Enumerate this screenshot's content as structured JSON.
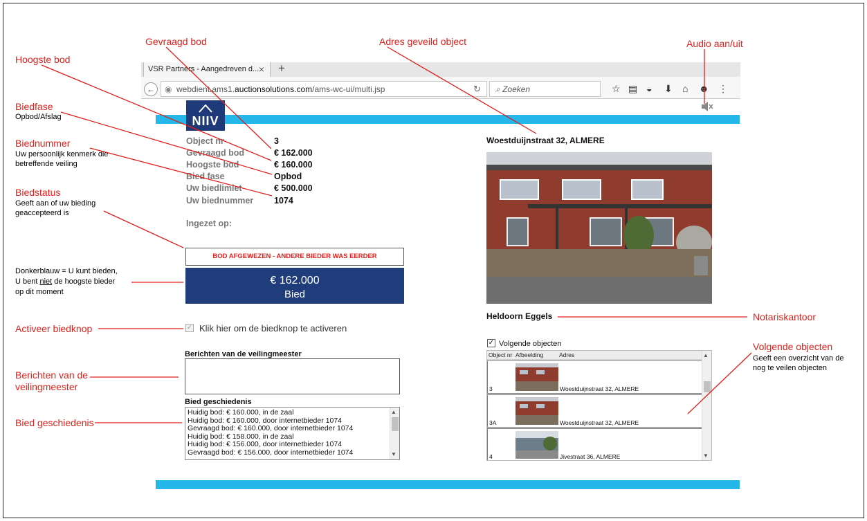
{
  "annotations": {
    "gevraagd_bod": "Gevraagd bod",
    "adres_geveild_object": "Adres geveild object",
    "audio": "Audio aan/uit",
    "hoogste_bod": "Hoogste bod",
    "biedfase": "Biedfase",
    "biedfase_sub": "Opbod/Afslag",
    "biednummer": "Biednummer",
    "biednummer_sub1": "Uw persoonlijk  kenmerk die",
    "biednummer_sub2": "betreffende veiling",
    "biedstatus": "Biedstatus",
    "biedstatus_sub1": "Geeft aan of uw bieding",
    "biedstatus_sub2": "geaccepteerd is",
    "donkerblauw_1": "Donkerblauw = U kunt bieden,",
    "donkerblauw_2a": "U bent ",
    "donkerblauw_2b": "niet",
    "donkerblauw_2c": " de hoogste bieder",
    "donkerblauw_3": "op dit moment",
    "activeer": "Activeer biedknop",
    "berichten_1": "Berichten van de",
    "berichten_2": "veilingmeester",
    "bied_geschiedenis": "Bied geschiedenis",
    "notariskantoor": "Notariskantoor",
    "volgende_objecten": "Volgende objecten",
    "volgende_sub1": "Geeft een overzicht van de",
    "volgende_sub2": "nog te veilen objecten"
  },
  "browser": {
    "tab_title": "VSR Partners - Aangedreven d...",
    "url_prefix": "webdient.ams1.",
    "url_host": "auctionsolutions.com",
    "url_path": "/ams-wc-ui/multi.jsp",
    "search_placeholder": "Zoeken"
  },
  "page": {
    "logo_text": "NIIV",
    "info": [
      {
        "label": "Object nr",
        "value": "3"
      },
      {
        "label": "Gevraagd bod",
        "value": "€ 162.000"
      },
      {
        "label": "Hoogste bod",
        "value": "€ 160.000"
      },
      {
        "label": "Bied fase",
        "value": "Opbod"
      },
      {
        "label": "Uw biedlimiet",
        "value": "€ 500.000"
      },
      {
        "label": "Uw biednummer",
        "value": "1074"
      }
    ],
    "ingezet_op": "Ingezet op:",
    "status": "BOD AFGEWEZEN - ANDERE BIEDER WAS EERDER",
    "bid_amount": "€ 162.000",
    "bid_label": "Bied",
    "activate_label": "Klik hier om de biedknop te activeren",
    "messages_title": "Berichten van de veilingmeester",
    "history_title": "Bied geschiedenis",
    "history": [
      "Huidig bod: € 160.000, in de zaal",
      "Huidig bod: € 160.000, door internetbieder 1074",
      "Gevraagd bod: € 160.000, door internetbieder 1074",
      "Huidig bod: € 158.000, in de zaal",
      "Huidig bod: € 156.000, door internetbieder 1074",
      "Gevraagd bod: € 156.000, door internetbieder 1074"
    ],
    "address": "Woestduijnstraat 32, ALMERE",
    "notaris": "Heldoorn Eggels",
    "next_objects_label": "Volgende objecten",
    "next_objects_headers": [
      "Object nr",
      "Afbeelding",
      "Adres"
    ],
    "next_objects": [
      {
        "nr": "3",
        "adres": "Woestduijnstraat 32, ALMERE"
      },
      {
        "nr": "3A",
        "adres": "Woestduijnstraat 32, ALMERE"
      },
      {
        "nr": "4",
        "adres": "Jivestraat 36, ALMERE"
      }
    ]
  },
  "colors": {
    "annotation": "#e0201b",
    "accent_bar": "#25b6ea",
    "bid_button": "#1f3d7a",
    "logo": "#1f3a78"
  }
}
